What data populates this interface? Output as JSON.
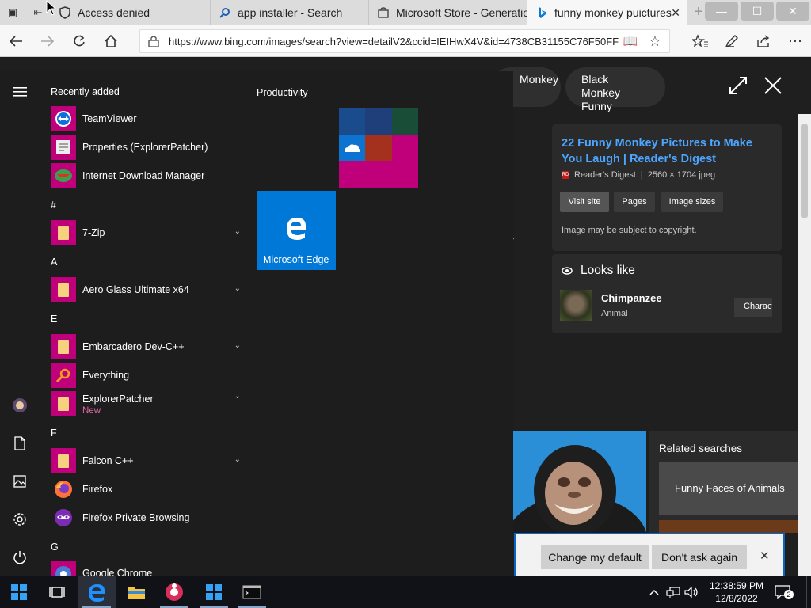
{
  "browser": {
    "tabs": [
      {
        "title": "Access denied",
        "icon": "shield-icon"
      },
      {
        "title": "app installer - Search",
        "icon": "search-icon"
      },
      {
        "title": "Microsoft Store - Generation",
        "icon": "store-icon"
      },
      {
        "title": "funny monkey puictures",
        "icon": "bing-icon",
        "active": true
      }
    ],
    "url": "https://www.bing.com/images/search?view=detailV2&ccid=IEIHwX4V&id=4738CB31155C76F50FF",
    "close_glyph": "✕",
    "new_tab_glyph": "+"
  },
  "viewer": {
    "chips": [
      {
        "line1": "",
        "line2": "Monkey"
      },
      {
        "line1": "Black",
        "line2": "Monkey Funny"
      }
    ],
    "result": {
      "title": "22 Funny Monkey Pictures to Make You Laugh | Reader's Digest",
      "source": "Reader's Digest",
      "separator": "|",
      "dims": "2560 × 1704 jpeg",
      "buttons": [
        "Visit site",
        "Pages",
        "Image sizes"
      ],
      "copyright": "Image may be subject to copyright."
    },
    "looks_like": {
      "heading": "Looks like",
      "name": "Chimpanzee",
      "category": "Animal",
      "button": "Charact"
    },
    "related": {
      "heading": "Related searches",
      "item": "Funny Faces of Animals"
    }
  },
  "banner": {
    "change_default": "Change my default",
    "dont_ask": "Don't ask again",
    "close_glyph": "✕"
  },
  "startmenu": {
    "recently_added": "Recently added",
    "recent": [
      "TeamViewer",
      "Properties (ExplorerPatcher)",
      "Internet Download Manager"
    ],
    "sections": {
      "hash": "#",
      "a": "A",
      "e": "E",
      "f": "F",
      "g": "G"
    },
    "apps": {
      "zip": "7-Zip",
      "aero": "Aero Glass Ultimate x64",
      "embarcadero": "Embarcadero Dev-C++",
      "everything": "Everything",
      "explorerpatcher": "ExplorerPatcher",
      "explorerpatcher_badge": "New",
      "falcon": "Falcon C++",
      "firefox": "Firefox",
      "firefox_private": "Firefox Private Browsing",
      "chrome": "Google Chrome"
    },
    "productivity": "Productivity",
    "edge_tile": "Microsoft Edge"
  },
  "taskbar": {
    "time": "12:38:59 PM",
    "date": "12/8/2022",
    "notifications": "2"
  },
  "colors": {
    "accent": "#0078d7",
    "tile_magenta": "#c0007a",
    "link_blue": "#4da6ff"
  }
}
